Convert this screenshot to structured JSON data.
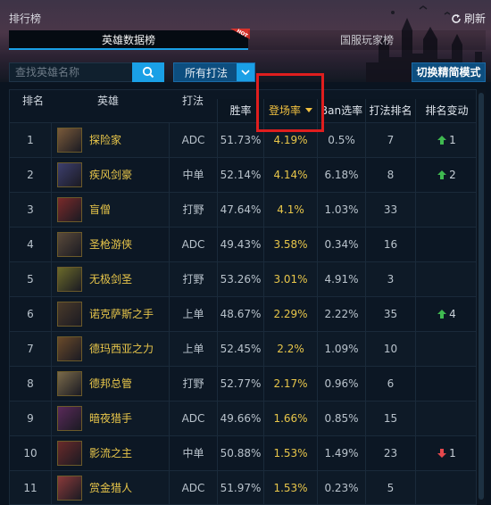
{
  "window": {
    "title": "排行榜",
    "refresh_label": "刷新"
  },
  "tabs": [
    {
      "label": "英雄数据榜",
      "active": true,
      "badge": "HOT"
    },
    {
      "label": "国服玩家榜",
      "active": false
    }
  ],
  "toolbar": {
    "search_placeholder": "查找英雄名称",
    "style_select_label": "所有打法",
    "simple_mode_label": "切换精简模式"
  },
  "table": {
    "columns": {
      "rank": "排名",
      "hero": "英雄",
      "role": "打法",
      "win_rate": "胜率",
      "pick_rate": "登场率",
      "ban_rate": "Ban选率",
      "role_rank": "打法排名",
      "rank_change": "排名变动"
    },
    "sorted_column": "pick_rate",
    "rows": [
      {
        "rank": "1",
        "hero": "探险家",
        "role": "ADC",
        "win": "51.73%",
        "pick": "4.19%",
        "ban": "0.5%",
        "role_rank": "7",
        "change_dir": "up",
        "change": "1",
        "color": "#7a5a3a"
      },
      {
        "rank": "2",
        "hero": "疾风剑豪",
        "role": "中单",
        "win": "52.14%",
        "pick": "4.14%",
        "ban": "6.18%",
        "role_rank": "8",
        "change_dir": "up",
        "change": "2",
        "color": "#3d3f6e"
      },
      {
        "rank": "3",
        "hero": "盲僧",
        "role": "打野",
        "win": "47.64%",
        "pick": "4.1%",
        "ban": "1.03%",
        "role_rank": "33",
        "change_dir": "",
        "change": "",
        "color": "#7a2a2a"
      },
      {
        "rank": "4",
        "hero": "圣枪游侠",
        "role": "ADC",
        "win": "49.43%",
        "pick": "3.58%",
        "ban": "0.34%",
        "role_rank": "16",
        "change_dir": "",
        "change": "",
        "color": "#5a4a3a"
      },
      {
        "rank": "5",
        "hero": "无极剑圣",
        "role": "打野",
        "win": "53.26%",
        "pick": "3.01%",
        "ban": "4.91%",
        "role_rank": "3",
        "change_dir": "",
        "change": "",
        "color": "#6b6a2a"
      },
      {
        "rank": "6",
        "hero": "诺克萨斯之手",
        "role": "上单",
        "win": "48.67%",
        "pick": "2.29%",
        "ban": "2.22%",
        "role_rank": "35",
        "change_dir": "up",
        "change": "4",
        "color": "#4a3a2a"
      },
      {
        "rank": "7",
        "hero": "德玛西亚之力",
        "role": "上单",
        "win": "52.45%",
        "pick": "2.2%",
        "ban": "1.09%",
        "role_rank": "10",
        "change_dir": "",
        "change": "",
        "color": "#6a4a2a"
      },
      {
        "rank": "8",
        "hero": "德邦总管",
        "role": "打野",
        "win": "52.77%",
        "pick": "2.17%",
        "ban": "0.96%",
        "role_rank": "6",
        "change_dir": "",
        "change": "",
        "color": "#7a6a4a"
      },
      {
        "rank": "9",
        "hero": "暗夜猎手",
        "role": "ADC",
        "win": "49.66%",
        "pick": "1.66%",
        "ban": "0.85%",
        "role_rank": "15",
        "change_dir": "",
        "change": "",
        "color": "#5a2a5a"
      },
      {
        "rank": "10",
        "hero": "影流之主",
        "role": "中单",
        "win": "50.88%",
        "pick": "1.53%",
        "ban": "1.49%",
        "role_rank": "23",
        "change_dir": "down",
        "change": "1",
        "color": "#6a2a2a"
      },
      {
        "rank": "11",
        "hero": "赏金猎人",
        "role": "ADC",
        "win": "51.97%",
        "pick": "1.53%",
        "ban": "0.23%",
        "role_rank": "5",
        "change_dir": "",
        "change": "",
        "color": "#8a3a3a"
      }
    ]
  },
  "colors": {
    "accent": "#1aa0e6",
    "gold": "#e8c64a",
    "up": "#3fb950",
    "down": "#e5484d",
    "highlight": "#e01e1e"
  }
}
